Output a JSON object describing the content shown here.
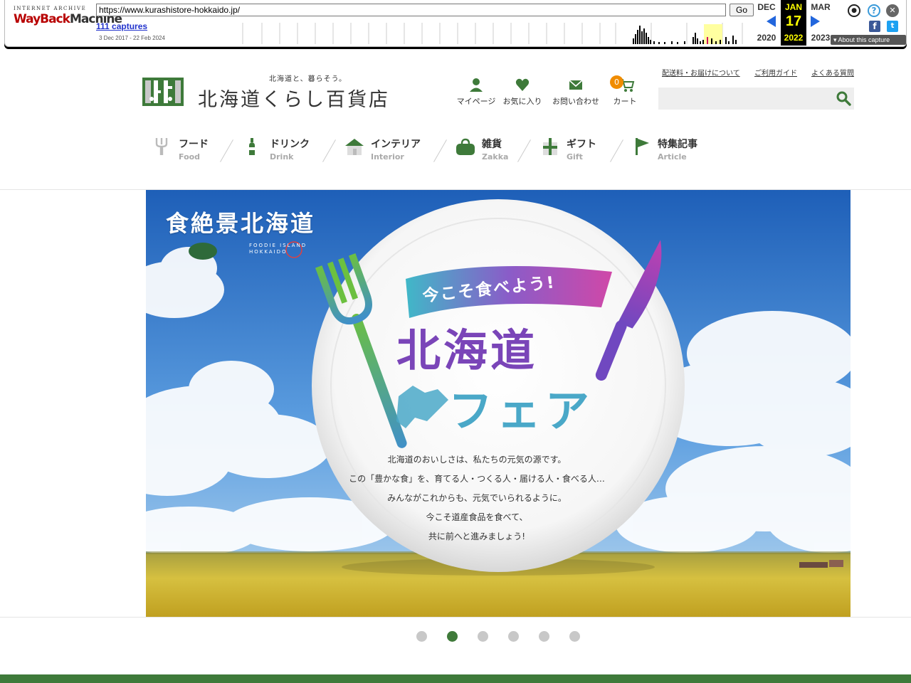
{
  "wayback": {
    "logo_top": "INTERNET ARCHIVE",
    "logo_main_1": "WayBack",
    "logo_main_2": "Machine",
    "url": "https://www.kurashistore-hokkaido.jp/",
    "go_label": "Go",
    "captures": "111 captures",
    "range": "3 Dec 2017 - 22 Feb 2024",
    "prev_month": "DEC",
    "prev_year": "2020",
    "cur_month": "JAN",
    "cur_day": "17",
    "cur_year": "2022",
    "next_month": "MAR",
    "next_year": "2023",
    "about": "About this capture",
    "icons": [
      "user-icon",
      "help-icon",
      "close-icon",
      "facebook-icon",
      "twitter-icon"
    ]
  },
  "header": {
    "tagline": "北海道と、暮らそう。",
    "store_name": "北海道くらし百貨店",
    "icons": {
      "mypage": "マイページ",
      "favorites": "お気に入り",
      "contact": "お問い合わせ",
      "cart": "カート",
      "cart_count": "0"
    },
    "links": [
      "配送料・お届けについて",
      "ご利用ガイド",
      "よくある質問"
    ],
    "search_placeholder": "",
    "accent": "#3e7a3a"
  },
  "categories": [
    {
      "jp": "フード",
      "en": "Food",
      "icon": "fork-icon"
    },
    {
      "jp": "ドリンク",
      "en": "Drink",
      "icon": "bottle-icon"
    },
    {
      "jp": "インテリア",
      "en": "Interior",
      "icon": "house-icon"
    },
    {
      "jp": "雑貨",
      "en": "Zakka",
      "icon": "bag-icon"
    },
    {
      "jp": "ギフト",
      "en": "Gift",
      "icon": "gift-icon"
    },
    {
      "jp": "特集記事",
      "en": "Article",
      "icon": "flag-icon"
    }
  ],
  "hero": {
    "title": "食絶景北海道",
    "foodie": [
      "FOODIE ISLAND",
      "HOKKAIDO"
    ],
    "banner": "今こそ食べよう!",
    "fair_line1": "北海道",
    "fair_line2": "フェア",
    "copy": [
      "北海道のおいしさは、私たちの元気の源です。",
      "この「豊かな食」を、育てる人・つくる人・届ける人・食べる人…",
      "みんながこれからも、元気でいられるように。",
      "今こそ道産食品を食べて、",
      "共に前へと進みましょう!"
    ]
  },
  "carousel": {
    "count": 6,
    "active": 2
  }
}
